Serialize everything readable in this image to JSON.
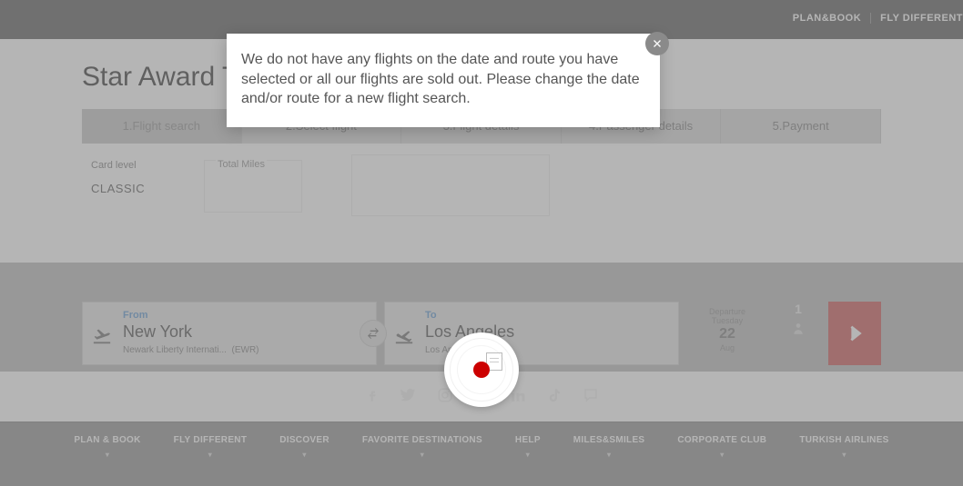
{
  "topnav": {
    "plan_book": "PLAN&BOOK",
    "fly_different": "FLY DIFFERENT"
  },
  "page_title": "Star Award T",
  "steps": [
    "1.Flight search",
    "2.Select flight",
    "3.Flight details",
    "4.Passenger details",
    "5.Payment"
  ],
  "card": {
    "level_label": "Card level",
    "level_value": "CLASSIC",
    "miles_label": "Total Miles"
  },
  "search": {
    "from_label": "From",
    "from_city": "New York",
    "from_sub": "Newark Liberty Internati...",
    "from_code": "(EWR)",
    "to_label": "To",
    "to_city": "Los Angeles",
    "to_sub": "Los Angeles Int",
    "dep_label": "Departure",
    "dep_dow": "Tuesday",
    "dep_day": "22",
    "dep_month": "Aug",
    "pax_count": "1"
  },
  "footer": {
    "items": [
      "PLAN & BOOK",
      "FLY DIFFERENT",
      "DISCOVER",
      "FAVORITE DESTINATIONS",
      "HELP",
      "MILES&SMILES",
      "CORPORATE CLUB",
      "TURKISH AIRLINES"
    ]
  },
  "modal": {
    "message": "We do not have any flights on the date and route you have selected or all our flights are sold out. Please change the date and/or route for a new flight search."
  }
}
